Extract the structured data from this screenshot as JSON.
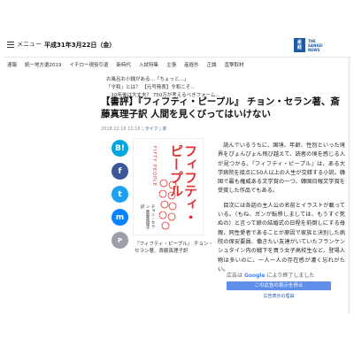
{
  "header": {
    "menu_label": "メニュー",
    "date": "平成31年3月22日（金）",
    "logo_mark": [
      "産",
      "経",
      "新",
      "聞"
    ],
    "logo_text": [
      "THE",
      "SANKEI",
      "NEWS"
    ]
  },
  "nav": {
    "items": [
      "速報",
      "統一地方選2019",
      "イチロー現役引退",
      "新時代",
      "入試特集",
      "主張",
      "産経抄",
      "正論",
      "直撃取材"
    ]
  },
  "tickers": [
    {
      "text": "お風呂お小銭がある…「ちょっと…」",
      "mark": ""
    },
    {
      "text": "「令和」とは？ 【元号発表】令和こそ…",
      "mark": ""
    },
    {
      "text": "…10年後は大丈夫？ 750万が考えるべきフォーム…",
      "mark": ""
    }
  ],
  "article": {
    "title": "【書評】『フィフティ・ピープル』 チョン・セラン著、斎藤真理子訳 人間を見くびってはいけない",
    "date": "2018.12.16 11:16",
    "category": "ライフ",
    "subcategory": "本",
    "paragraphs": [
      "読んでいるうちに、国境、年齢、性別といった境界をぴょんぴょん飛び越えて、読者の境を感じる人が見つかる。『フィフティ・ピープル』は、ある大学病院を接点に50人以上の人生が交錯する小説。韓国で最も権威ある文学賞の一つ、韓国日報文学賞を受賞した作品でもある。",
      "目次には各話の主人公の名前とイラストが載っている。（もね、ガンが転移しましては、もうすぐ死ぬの）と言って娘の結婚式の日程を前倒しにする母親、同性愛者であることが原因で家族と決別した病院の保安要員、働きたい友達がいていたフランケンシュタイン内の戦下を買う女子高校生など、登場人物は多いのに、一人一人の存在感が濃く忘れがたい。"
    ]
  },
  "book": {
    "cover_title": "フィフティ・ピープル",
    "cover_sub": "FIFTY PEOPLE",
    "cover_author": "チョン・セラン 斎藤真理子 訳",
    "caption": "『フィフティ・ピープル』 チョン・セラン著、斎藤真理子訳"
  },
  "share": {
    "hatena": "B!",
    "facebook": "f",
    "twitter": "t",
    "messenger": "m",
    "pinterest": "P"
  },
  "ad": {
    "head_prefix": "広告は",
    "head_brand": "Google",
    "head_suffix": "により終了しました",
    "button": "この広告の表示を停止",
    "why": "広告表示の理由"
  },
  "colors": {
    "brand": "#1e5aa6",
    "cover_red": "#e0322f",
    "facebook": "#3b5998",
    "twitter": "#1da1f2"
  }
}
